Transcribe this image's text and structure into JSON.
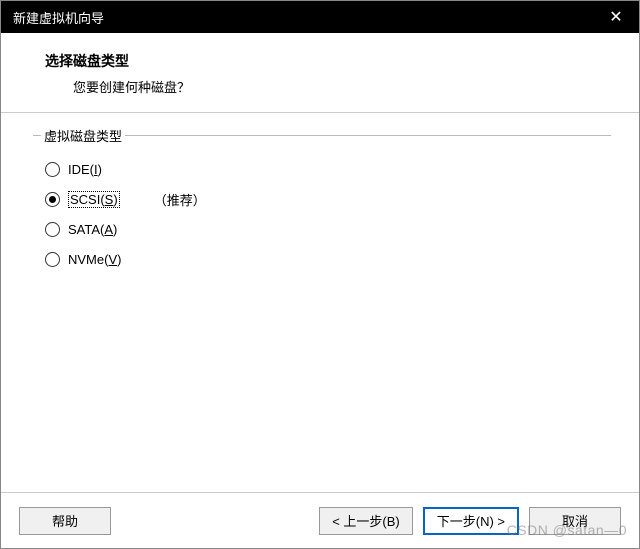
{
  "titlebar": {
    "title": "新建虚拟机向导",
    "close_icon": "✕"
  },
  "header": {
    "title": "选择磁盘类型",
    "subtitle": "您要创建何种磁盘？"
  },
  "fieldset": {
    "legend": "虚拟磁盘类型"
  },
  "radios": {
    "ide": {
      "text": "IDE(",
      "key": "I",
      "suffix": ")"
    },
    "scsi": {
      "text": "SCSI(",
      "key": "S",
      "suffix": ")",
      "recommend": "（推荐）"
    },
    "sata": {
      "text": "SATA(",
      "key": "A",
      "suffix": ")"
    },
    "nvme": {
      "text": "NVMe(",
      "key": "V",
      "suffix": ")"
    }
  },
  "buttons": {
    "help": "帮助",
    "back": "< 上一步(B)",
    "next": "下一步(N) >",
    "cancel": "取消"
  },
  "watermark": "CSDN @satan—0"
}
